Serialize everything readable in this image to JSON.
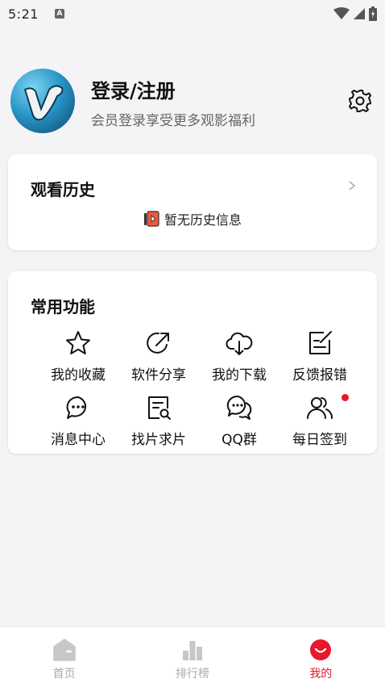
{
  "status_bar": {
    "time": "5:21",
    "notification_letter": "A"
  },
  "profile": {
    "title": "登录/注册",
    "subtitle": "会员登录享受更多观影福利"
  },
  "history": {
    "title": "观看历史",
    "empty_text": "暂无历史信息"
  },
  "functions": {
    "title": "常用功能",
    "items": [
      {
        "label": "我的收藏",
        "icon": "star-icon"
      },
      {
        "label": "软件分享",
        "icon": "share-icon"
      },
      {
        "label": "我的下载",
        "icon": "cloud-download-icon"
      },
      {
        "label": "反馈报错",
        "icon": "feedback-icon"
      },
      {
        "label": "消息中心",
        "icon": "message-icon"
      },
      {
        "label": "找片求片",
        "icon": "search-doc-icon"
      },
      {
        "label": "QQ群",
        "icon": "chat-group-icon"
      },
      {
        "label": "每日签到",
        "icon": "users-icon"
      }
    ]
  },
  "bottom_nav": [
    {
      "label": "首页"
    },
    {
      "label": "排行榜"
    },
    {
      "label": "我的"
    }
  ],
  "colors": {
    "accent": "#e8172d",
    "inactive": "#aaaaaa",
    "background": "#f4f4f6"
  }
}
